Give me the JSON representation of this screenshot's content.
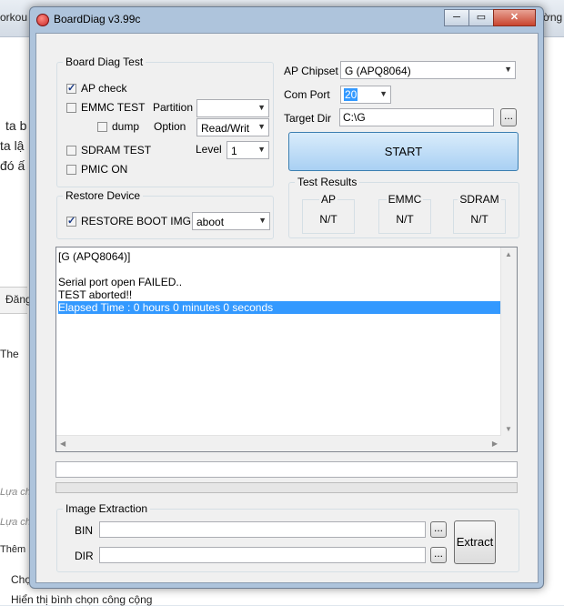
{
  "window": {
    "title": "BoardDiag v3.99c",
    "caption_minimize": "─",
    "caption_maximize": "▭",
    "caption_close": "✕"
  },
  "background": {
    "tab_left": "orkou",
    "tab_right": "ờng",
    "lines": [
      "ta b",
      "ta lậ",
      "đó ấ",
      "Đăng",
      "The",
      "Lựa ch",
      "Lựa ch",
      "Thêm",
      "Chọ",
      "Hiển thị bình chọn công cộng"
    ]
  },
  "board_diag_test": {
    "title": "Board Diag Test",
    "ap_check": {
      "label": "AP check",
      "checked": true
    },
    "emmc_test": {
      "label": "EMMC TEST",
      "checked": false
    },
    "dump": {
      "label": "dump",
      "checked": false
    },
    "partition": {
      "label": "Partition",
      "value": ""
    },
    "option": {
      "label": "Option",
      "value": "Read/Writ"
    },
    "sdram_test": {
      "label": "SDRAM TEST",
      "checked": false
    },
    "level": {
      "label": "Level",
      "value": "1"
    },
    "pmic_on": {
      "label": "PMIC ON",
      "checked": false
    }
  },
  "restore_device": {
    "title": "Restore Device",
    "restore_boot_img": {
      "label": "RESTORE BOOT IMG",
      "checked": true
    },
    "image": {
      "value": "aboot"
    }
  },
  "settings": {
    "ap_chipset": {
      "label": "AP Chipset",
      "value": "G (APQ8064)"
    },
    "com_port": {
      "label": "Com Port",
      "value": "20"
    },
    "target_dir": {
      "label": "Target Dir",
      "value": "C:\\G"
    },
    "browse_label": "...",
    "start_label": "START"
  },
  "test_results": {
    "title": "Test Results",
    "items": [
      {
        "name": "AP",
        "value": "N/T"
      },
      {
        "name": "EMMC",
        "value": "N/T"
      },
      {
        "name": "SDRAM",
        "value": "N/T"
      }
    ]
  },
  "log": {
    "lines": [
      "[G (APQ8064)]",
      "",
      "Serial port open FAILED..",
      "TEST aborted!!",
      "Elapsed Time : 0 hours 0 minutes 0 seconds"
    ],
    "selected_index": 4
  },
  "progress": 0,
  "image_extraction": {
    "title": "Image Extraction",
    "bin": {
      "label": "BIN",
      "value": ""
    },
    "dir": {
      "label": "DIR",
      "value": ""
    },
    "browse_label": "...",
    "extract_label": "Extract"
  },
  "colors": {
    "selection": "#3399ff",
    "start_button": "#bcd7f2",
    "titlebar": "#aec4dc"
  }
}
